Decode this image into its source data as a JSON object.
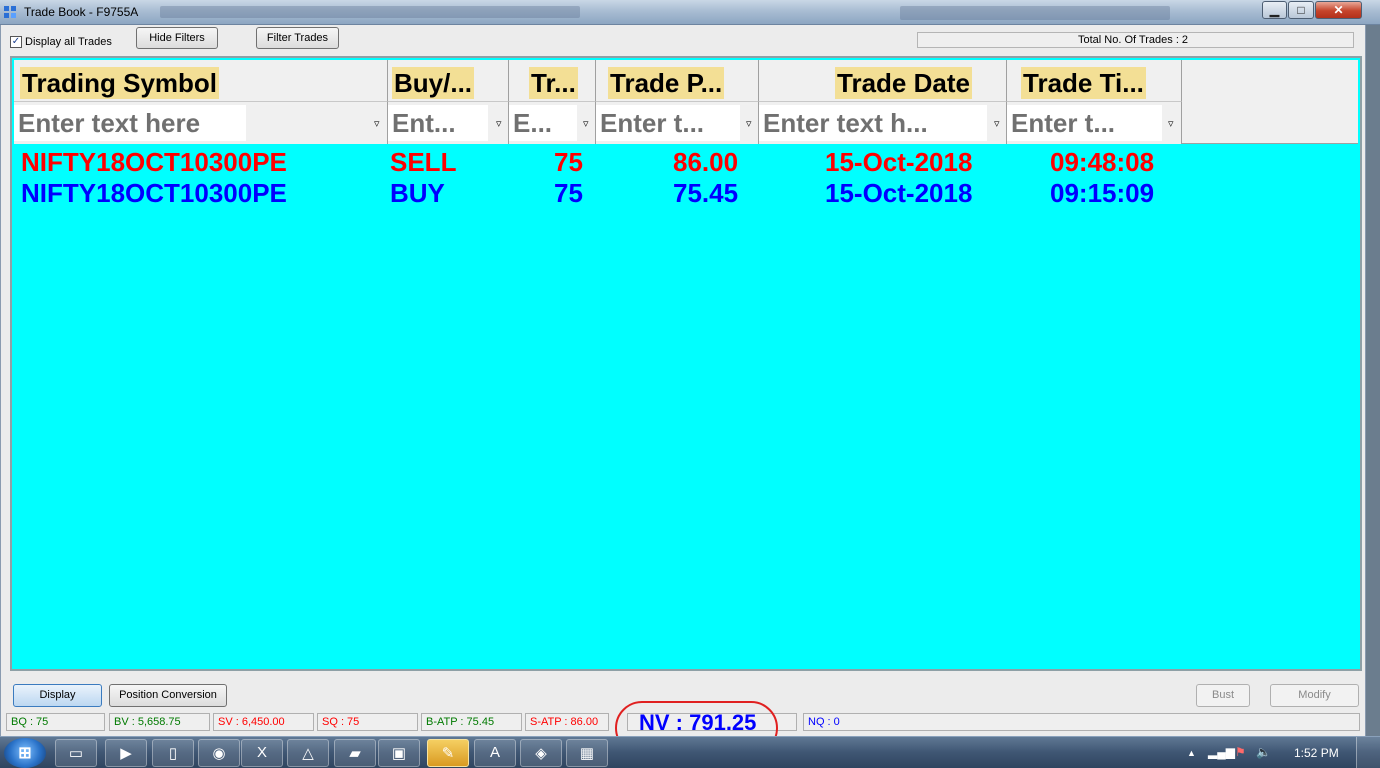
{
  "window": {
    "title": "Trade Book - F9755A",
    "controls": {
      "minimize": "▁",
      "maximize": "□",
      "close": "✕"
    }
  },
  "toolbar": {
    "display_all_label": "Display all Trades",
    "display_all_checked": "✓",
    "hide_filters_label": "Hide Filters",
    "filter_trades_label": "Filter Trades",
    "total_trades_label": "Total No. Of Trades : 2"
  },
  "grid": {
    "columns": [
      {
        "header": "Trading Symbol",
        "filter_placeholder": "Enter text here"
      },
      {
        "header": "Buy/...",
        "filter_placeholder": "Ent..."
      },
      {
        "header": "Tr...",
        "filter_placeholder": "E..."
      },
      {
        "header": "Trade P...",
        "filter_placeholder": "Enter t..."
      },
      {
        "header": "Trade Date",
        "filter_placeholder": "Enter text h..."
      },
      {
        "header": "Trade Ti...",
        "filter_placeholder": "Enter t..."
      }
    ],
    "rows": [
      {
        "symbol": "NIFTY18OCT10300PE",
        "side": "SELL",
        "qty": "75",
        "price": "86.00",
        "date": "15-Oct-2018",
        "time": "09:48:08",
        "color": "#ff0000"
      },
      {
        "symbol": "NIFTY18OCT10300PE",
        "side": "BUY",
        "qty": "75",
        "price": "75.45",
        "date": "15-Oct-2018",
        "time": "09:15:09",
        "color": "#0000ff"
      }
    ],
    "background": "#00ffff"
  },
  "bottom_buttons": {
    "display": "Display",
    "position_conversion": "Position Conversion",
    "bust": "Bust",
    "modify": "Modify"
  },
  "status_bar": {
    "bq": "BQ : 75",
    "bv": "BV : 5,658.75",
    "sv": "SV : 6,450.00",
    "sq": "SQ : 75",
    "batp": "B-ATP : 75.45",
    "satp": "S-ATP : 86.00",
    "nv": "NV : 791.25",
    "nq": "NQ : 0"
  },
  "taskbar": {
    "start_icon": "windows-start-icon",
    "apps": [
      {
        "icon": "file-explorer-icon",
        "glyph": "▭"
      },
      {
        "icon": "media-player-icon",
        "glyph": "▶"
      },
      {
        "icon": "document-icon",
        "glyph": "▯"
      },
      {
        "icon": "chrome-icon",
        "glyph": "◉"
      },
      {
        "icon": "excel-icon",
        "glyph": "X"
      },
      {
        "icon": "app-triangle-icon",
        "glyph": "△"
      },
      {
        "icon": "network-icon",
        "glyph": "▰"
      },
      {
        "icon": "window-icon",
        "glyph": "▣"
      },
      {
        "icon": "trading-app-icon",
        "glyph": "✎"
      },
      {
        "icon": "pdf-reader-icon",
        "glyph": "A"
      },
      {
        "icon": "chart-app-icon",
        "glyph": "◈"
      },
      {
        "icon": "calculator-icon",
        "glyph": "▦"
      }
    ],
    "tray": {
      "arrow": "▲",
      "signal": "▂▄▆",
      "flag": "⚑",
      "volume": "🔈"
    },
    "clock": "1:52 PM"
  },
  "colors": {
    "sell": "#ff0000",
    "buy": "#0000ff",
    "header_highlight": "#f3df95",
    "annotation_circle": "#e02020"
  }
}
